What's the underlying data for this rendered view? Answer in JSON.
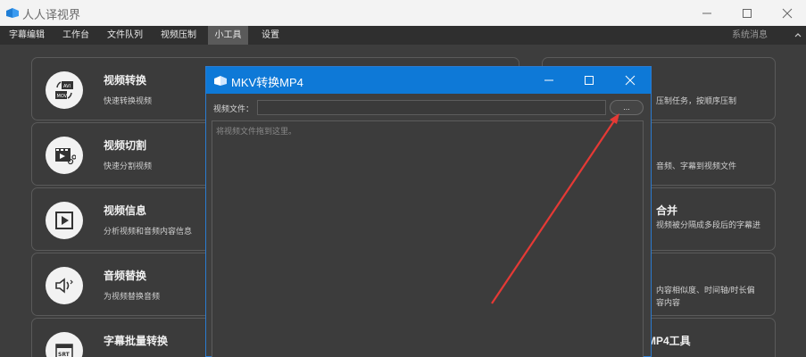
{
  "app": {
    "title": "人人译视界"
  },
  "menu": {
    "items": [
      {
        "label": "字幕编辑",
        "active": false
      },
      {
        "label": "工作台",
        "active": false
      },
      {
        "label": "文件队列",
        "active": false
      },
      {
        "label": "视频压制",
        "active": false
      },
      {
        "label": "小工具",
        "active": true
      },
      {
        "label": "设置",
        "active": false
      }
    ],
    "system_messages": "系统消息"
  },
  "left_cards": [
    {
      "title": "视频转换",
      "desc": "快速转换视频",
      "icon": "video-convert-icon"
    },
    {
      "title": "视频切割",
      "desc": "快速分割视频",
      "icon": "video-cut-icon"
    },
    {
      "title": "视频信息",
      "desc": "分析视频和音频内容信息",
      "icon": "video-info-icon"
    },
    {
      "title": "音频替换",
      "desc": "为视频替换音频",
      "icon": "audio-replace-icon"
    },
    {
      "title": "字幕批量转换",
      "desc": "",
      "icon": "srt-icon"
    }
  ],
  "right_cards": [
    {
      "title": "",
      "desc": [
        "压制任务，按顺序压制"
      ]
    },
    {
      "title": "",
      "desc": [
        "音频、字幕到视频文件"
      ]
    },
    {
      "title": "合并",
      "desc": [
        "视频被分隔成多段后的字幕进"
      ]
    },
    {
      "title": "",
      "desc": [
        "内容相似度、时间轴/时长偏",
        "容内容"
      ]
    },
    {
      "title": "MP4工具",
      "desc": []
    }
  ],
  "dialog": {
    "title": "MKV转换MP4",
    "file_label": "视频文件：",
    "file_value": "",
    "browse_label": "...",
    "drop_hint": "将视频文件拖到这里。"
  },
  "colors": {
    "accent": "#0e79d7",
    "arrow": "#e53935",
    "card_border": "#5a5a5a"
  }
}
